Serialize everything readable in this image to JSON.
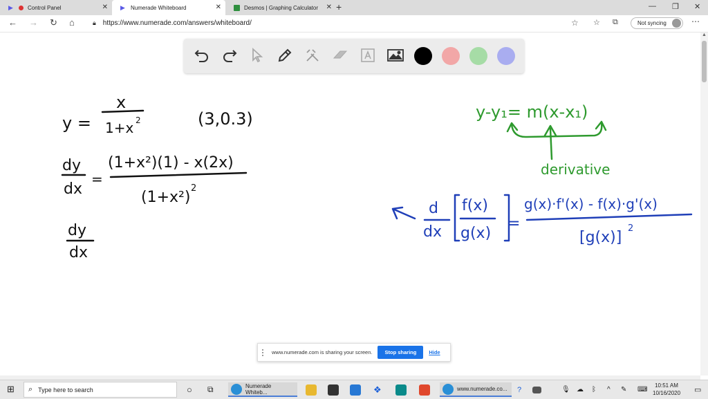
{
  "browser": {
    "tabs": [
      {
        "label": "Control Panel",
        "active": false
      },
      {
        "label": "Numerade Whiteboard",
        "active": true
      },
      {
        "label": "Desmos | Graphing Calculator",
        "active": false
      }
    ],
    "url": "https://www.numerade.com/answers/whiteboard/",
    "sync_label": "Not syncing"
  },
  "toolbar": {
    "tools": [
      "undo-icon",
      "redo-icon",
      "pointer-icon",
      "pen-icon",
      "tools-icon",
      "eraser-icon",
      "text-icon",
      "image-icon"
    ],
    "colors": [
      "#000000",
      "#f2a7a7",
      "#a6dca6",
      "#a9adf0"
    ]
  },
  "board": {
    "black": {
      "eq1_lhs": "y =",
      "eq1_num": "x",
      "eq1_den": "1+x",
      "eq1_den_exp": "2",
      "point": "(3,0.3)",
      "eq2_lhs_num": "dy",
      "eq2_lhs_den": "dx",
      "eq2_eq": "=",
      "eq2_num": "(1+x²)(1) - x(2x)",
      "eq2_den": "(1+x²)",
      "eq2_den_exp": "2",
      "eq3_num": "dy",
      "eq3_den": "dx"
    },
    "green": {
      "line_eq": "y-y₁= m(x-x₁)",
      "label": "derivative"
    },
    "blue": {
      "d": "d",
      "dx": "dx",
      "f": "f(x)",
      "g": "g(x)",
      "eq": "=",
      "num": "g(x)·f'(x) - f(x)·g'(x)",
      "den": "[g(x)]",
      "den_exp": "2"
    },
    "colors": {
      "black": "#111111",
      "green": "#2e9a2e",
      "blue": "#1f3fb8"
    }
  },
  "share": {
    "message": "www.numerade.com is sharing your screen.",
    "stop_label": "Stop sharing",
    "hide_label": "Hide"
  },
  "taskbar": {
    "search_placeholder": "Type here to search",
    "apps": [
      {
        "label": "Numerade Whiteb..."
      },
      {
        "label": "www.numerade.co..."
      }
    ],
    "time": "10:51 AM",
    "date": "10/16/2020"
  }
}
